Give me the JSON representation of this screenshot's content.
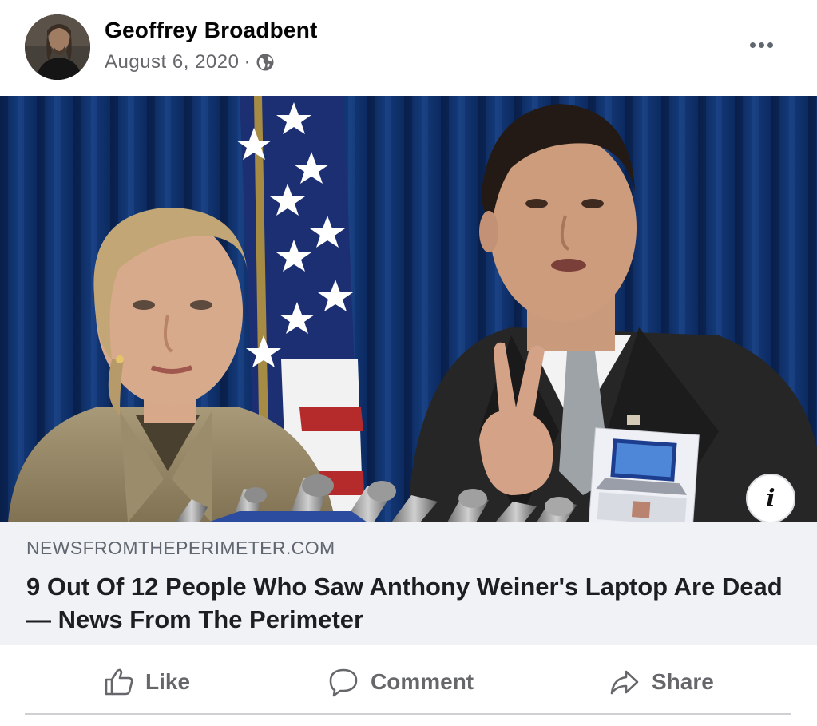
{
  "post": {
    "author": "Geoffrey Broadbent",
    "date": "August 6, 2020",
    "separator": "·",
    "audience_icon": "globe-icon",
    "more_icon": "more-options-icon"
  },
  "link_preview": {
    "domain": "NEWSFROMTHEPERIMETER.COM",
    "headline": "9 Out Of 12 People Who Saw Anthony Weiner's Laptop Are Dead — News From The Perimeter",
    "info_icon_label": "i"
  },
  "actions": {
    "like": "Like",
    "comment": "Comment",
    "share": "Share"
  },
  "colors": {
    "secondary_text": "#65676b",
    "link_box_bg": "#f0f2f5",
    "curtain": "#0e2a5c"
  }
}
